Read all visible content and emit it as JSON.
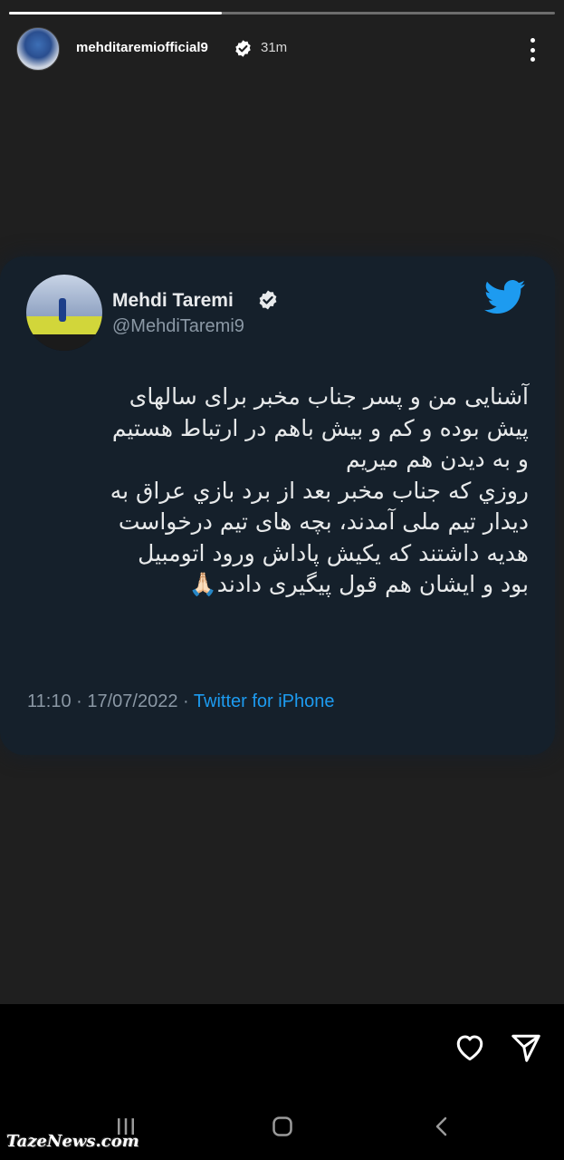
{
  "story": {
    "progress_fraction": 0.39,
    "username": "mehditaremiofficial9",
    "verified": true,
    "time_ago": "31m"
  },
  "tweet": {
    "display_name": "Mehdi Taremi",
    "handle": "@MehdiTaremi9",
    "verified": true,
    "text": "آشنایی من و پسر جناب مخبر برای سالهای\nپیش بوده و کم و بیش باهم در ارتباط هستیم\nو به دیدن هم میریم\nروزي که جناب مخبر بعد از برد بازي عراق به\nدیدار تیم ملی آمدند، بچه های تیم درخواست\nهدیه داشتند که یکیش پاداش ورود اتومبیل\nبود و ایشان هم قول پیگیری دادند🙏🏻",
    "time": "11:10",
    "date": "17/07/2022",
    "separator": " · ",
    "source": "Twitter for iPhone"
  },
  "icons": {
    "story_more": "more-vertical-icon",
    "heart": "heart-icon",
    "send": "send-icon",
    "twitter": "twitter-bird-icon"
  },
  "colors": {
    "story_background": "#1f1f1f",
    "tweet_card_background": "#15202b",
    "twitter_blue": "#1d9bf0",
    "tweet_secondary_text": "#8b98a5"
  },
  "watermark": "TazeNews.com"
}
